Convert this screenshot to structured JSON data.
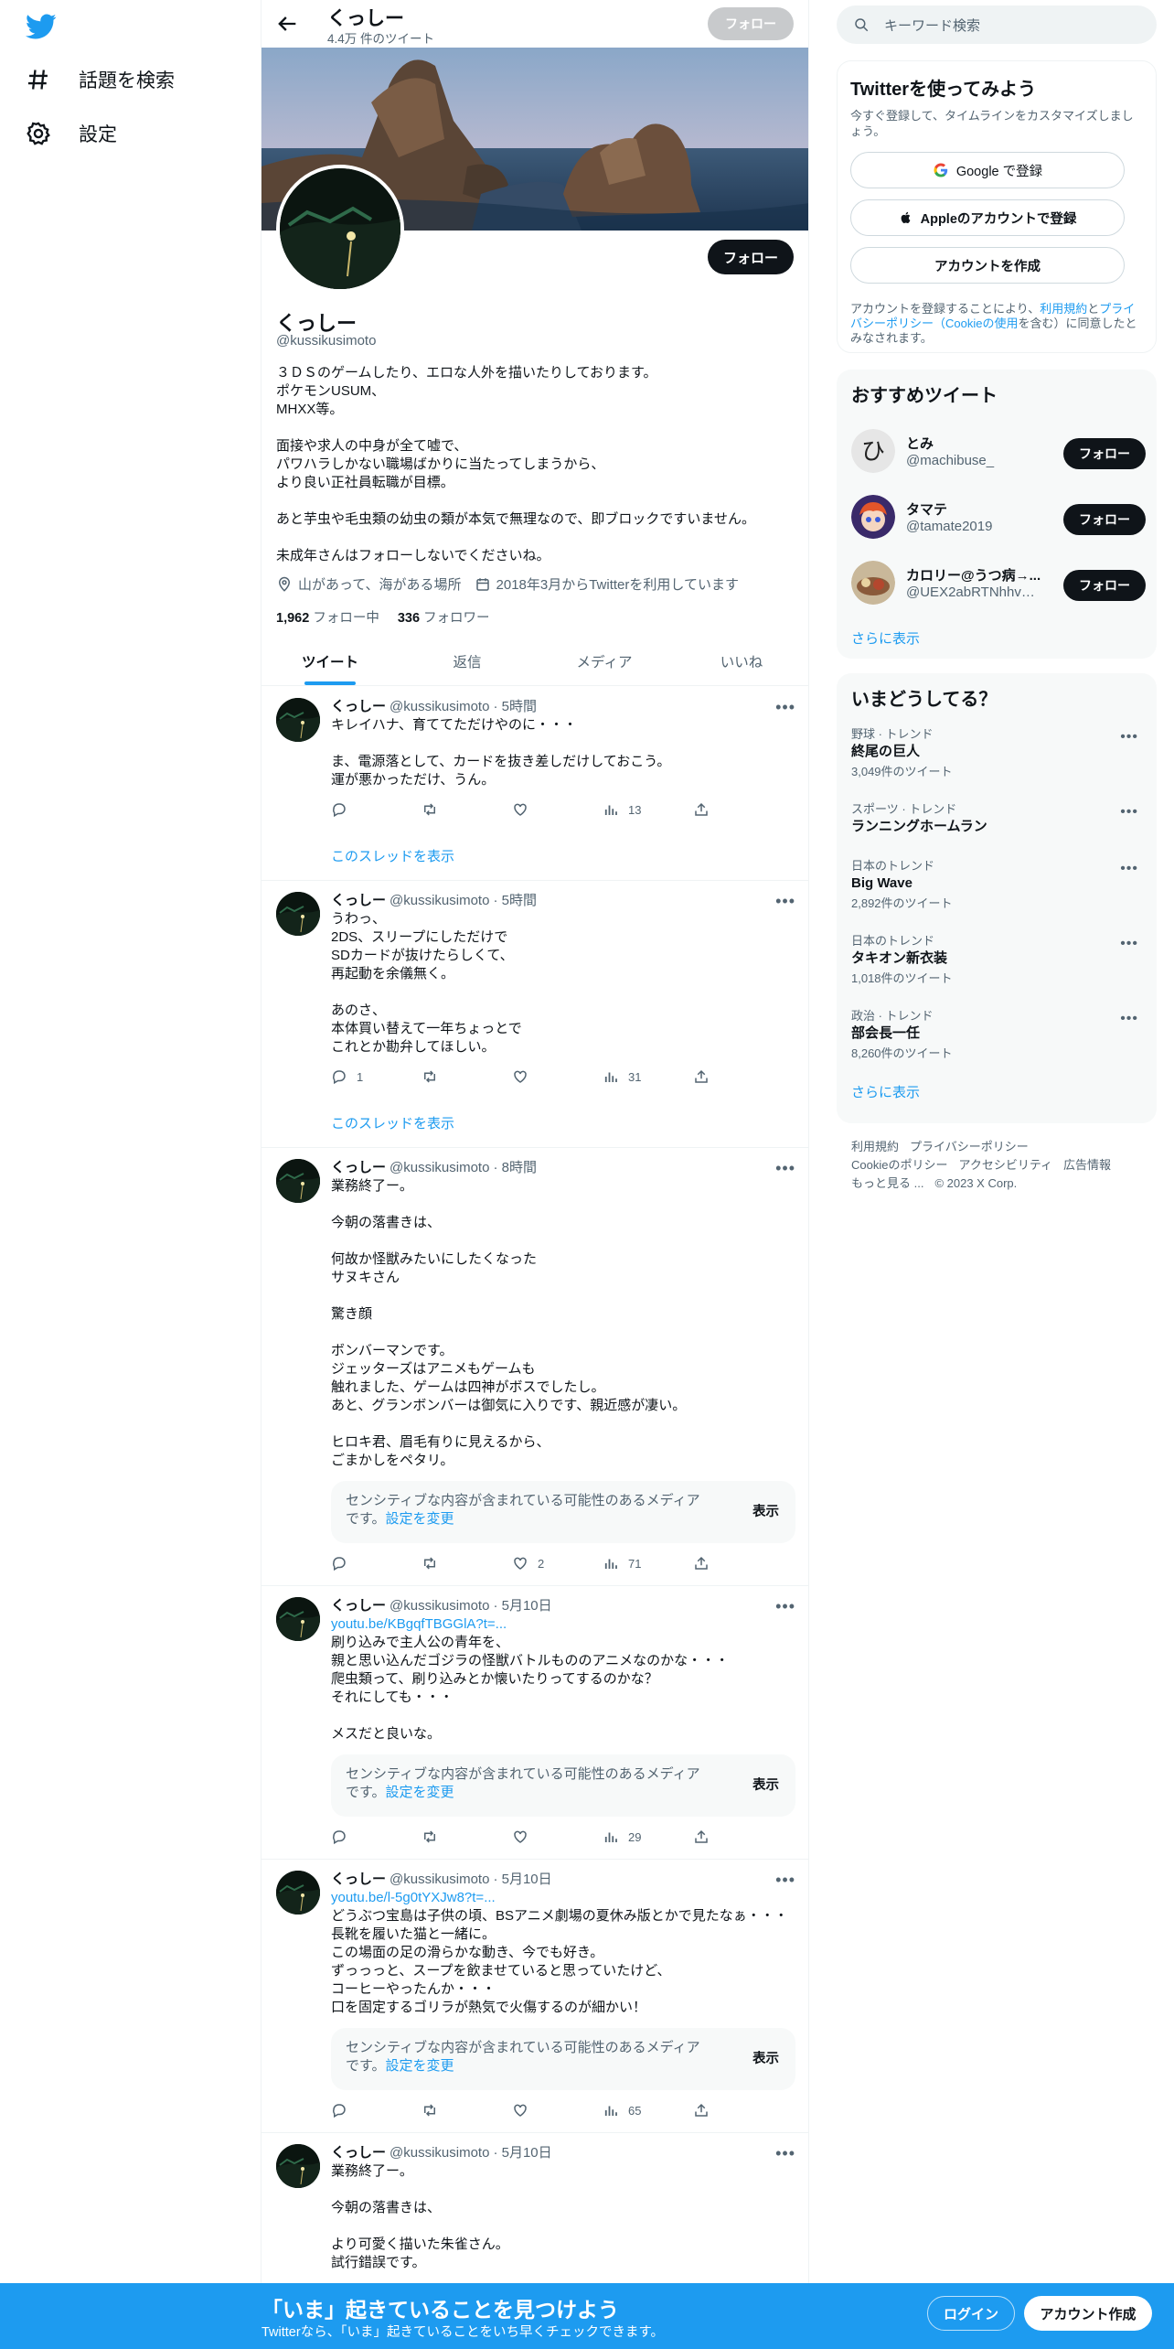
{
  "nav": {
    "explore_label": "話題を検索",
    "settings_label": "設定"
  },
  "header": {
    "name": "くっしー",
    "tweet_count": "4.4万 件のツイート",
    "follow_label": "フォロー"
  },
  "profile": {
    "name": "くっしー",
    "handle": "@kussikusimoto",
    "follow_label": "フォロー",
    "bio": "３ＤＳのゲームしたり、エロな人外を描いたりしております。\nポケモンUSUM、\nMHXX等。\n\n面接や求人の中身が全て嘘で、\nパワハラしかない職場ばかりに当たってしまうから、\nより良い正社員転職が目標。\n\nあと芋虫や毛虫類の幼虫の類が本気で無理なので、即ブロックですいません。\n\n未成年さんはフォローしないでくださいね。",
    "location": "山があって、海がある場所",
    "joined": "2018年3月からTwitterを利用しています",
    "following_count": "1,962",
    "following_label": "フォロー中",
    "followers_count": "336",
    "followers_label": "フォロワー"
  },
  "tabs": [
    "ツイート",
    "返信",
    "メディア",
    "いいね"
  ],
  "tweets": [
    {
      "name": "くっしー",
      "handle": "@kussikusimoto",
      "time": "· 5時間",
      "link": "",
      "text": "キレイハナ、育ててただけやのに・・・\n\nま、電源落として、カードを抜き差しだけしておこう。\n運が悪かっただけ、うん。",
      "replies": "",
      "retweets": "",
      "likes": "",
      "views": "13",
      "thread_label": "このスレッドを表示"
    },
    {
      "name": "くっしー",
      "handle": "@kussikusimoto",
      "time": "· 5時間",
      "link": "",
      "text": "うわっ、\n2DS、スリープにしただけで\nSDカードが抜けたらしくて、\n再起動を余儀無く。\n\nあのさ、\n本体買い替えて一年ちょっとで\nこれとか勘弁してほしい。",
      "replies": "1",
      "retweets": "",
      "likes": "",
      "views": "31",
      "thread_label": "このスレッドを表示"
    },
    {
      "name": "くっしー",
      "handle": "@kussikusimoto",
      "time": "· 8時間",
      "link": "",
      "text": "業務終了ー。\n\n今朝の落書きは、\n\n何故か怪獣みたいにしたくなった\nサヌキさん\n\n驚き顔\n\nボンバーマンです。\nジェッターズはアニメもゲームも\n触れました、ゲームは四神がボスでしたし。\nあと、グランボンバーは御気に入りです、親近感が凄い。\n\nヒロキ君、眉毛有りに見えるから、\nごまかしをペタリ。",
      "sensitive": "センシティブな内容が含まれている可能性のあるメディアです。",
      "sensitive_change": "設定を変更",
      "sensitive_show": "表示",
      "replies": "",
      "retweets": "",
      "likes": "2",
      "views": "71"
    },
    {
      "name": "くっしー",
      "handle": "@kussikusimoto",
      "time": "· 5月10日",
      "link": "youtu.be/KBgqfTBGGlA?t=...",
      "text": "刷り込みで主人公の青年を、\n親と思い込んだゴジラの怪獣バトルもののアニメなのかな・・・\n爬虫類って、刷り込みとか懐いたりってするのかな？\nそれにしても・・・\n\nメスだと良いな。",
      "sensitive": "センシティブな内容が含まれている可能性のあるメディアです。",
      "sensitive_change": "設定を変更",
      "sensitive_show": "表示",
      "replies": "",
      "retweets": "",
      "likes": "",
      "views": "29"
    },
    {
      "name": "くっしー",
      "handle": "@kussikusimoto",
      "time": "· 5月10日",
      "link": "youtu.be/l-5g0tYXJw8?t=...",
      "text": "どうぶつ宝島は子供の頃、BSアニメ劇場の夏休み版とかで見たなぁ・・・\n長靴を履いた猫と一緒に。\nこの場面の足の滑らかな動き、今でも好き。\nずっっっと、スープを飲ませていると思っていたけど、\nコーヒーやったんか・・・\n口を固定するゴリラが熱気で火傷するのが細かい！",
      "sensitive": "センシティブな内容が含まれている可能性のあるメディアです。",
      "sensitive_change": "設定を変更",
      "sensitive_show": "表示",
      "replies": "",
      "retweets": "",
      "likes": "",
      "views": "65"
    },
    {
      "name": "くっしー",
      "handle": "@kussikusimoto",
      "time": "· 5月10日",
      "link": "",
      "text": "業務終了ー。\n\n今朝の落書きは、\n\nより可愛く描いた朱雀さん。\n試行錯誤です。",
      "replies": "",
      "retweets": "",
      "likes": "",
      "views": ""
    }
  ],
  "search": {
    "placeholder": "キーワード検索"
  },
  "signup": {
    "title": "Twitterを使ってみよう",
    "subtitle": "今すぐ登録して、タイムラインをカスタマイズしましょう。",
    "google_label": "Google で登録",
    "apple_label": "Appleのアカウントで登録",
    "create_label": "アカウントを作成",
    "legal_prefix": "アカウントを登録することにより、",
    "legal_terms": "利用規約",
    "legal_and": "と",
    "legal_privacy": "プライバシーポリシー（Cookieの使用",
    "legal_suffix": "を含む）に同意したとみなされます。"
  },
  "recommend": {
    "title": "おすすめツイート",
    "users": [
      {
        "name": "とみ",
        "handle": "@machibuse_",
        "follow": "フォロー"
      },
      {
        "name": "タマテ",
        "handle": "@tamate2019",
        "follow": "フォロー"
      },
      {
        "name": "カロリー@うつ病→...",
        "handle": "@UEX2abRTNhhvW...",
        "follow": "フォロー"
      }
    ],
    "more_label": "さらに表示"
  },
  "trends": {
    "title": "いまどうしてる？",
    "items": [
      {
        "category": "野球 · トレンド",
        "name": "終尾の巨人",
        "count": "3,049件のツイート"
      },
      {
        "category": "スポーツ · トレンド",
        "name": "ランニングホームラン",
        "count": ""
      },
      {
        "category": "日本のトレンド",
        "name": "Big Wave",
        "count": "2,892件のツイート"
      },
      {
        "category": "日本のトレンド",
        "name": "タキオン新衣装",
        "count": "1,018件のツイート"
      },
      {
        "category": "政治 · トレンド",
        "name": "部会長一任",
        "count": "8,260件のツイート"
      }
    ],
    "more_label": "さらに表示"
  },
  "footer": {
    "terms": "利用規約",
    "privacy": "プライバシーポリシー",
    "cookie": "Cookieのポリシー",
    "accessibility": "アクセシビリティ",
    "ads": "広告情報",
    "more": "もっと見る ...",
    "copyright": "© 2023 X Corp."
  },
  "bottom_bar": {
    "title": "「いま」起きていることを見つけよう",
    "subtitle": "Twitterなら、「いま」起きていることをいち早くチェックできます。",
    "login_label": "ログイン",
    "signup_label": "アカウント作成"
  },
  "colors": {
    "accent": "#1d9bf0",
    "text": "#0f1419",
    "muted": "#536471"
  }
}
